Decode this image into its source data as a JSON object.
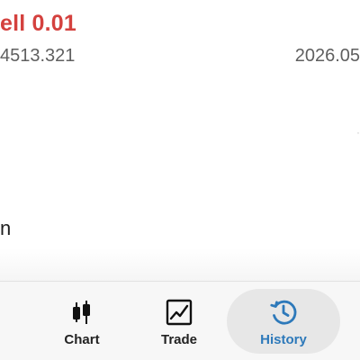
{
  "order": {
    "title": "ell 0.01",
    "price": "4513.321",
    "time": "2026.05",
    "fragment": "n"
  },
  "bottom_nav": {
    "items": [
      {
        "label": "Chart",
        "icon": "candlestick-chart-icon",
        "active": false
      },
      {
        "label": "Trade",
        "icon": "line-trend-icon",
        "active": false
      },
      {
        "label": "History",
        "icon": "history-clock-icon",
        "active": true
      }
    ]
  },
  "colors": {
    "sell_red": "#d4413e",
    "active_blue": "#2d79ba",
    "text_gray": "#5f5f5f",
    "nav_background": "#f7f7f7",
    "active_pill": "#e7e7e7"
  }
}
